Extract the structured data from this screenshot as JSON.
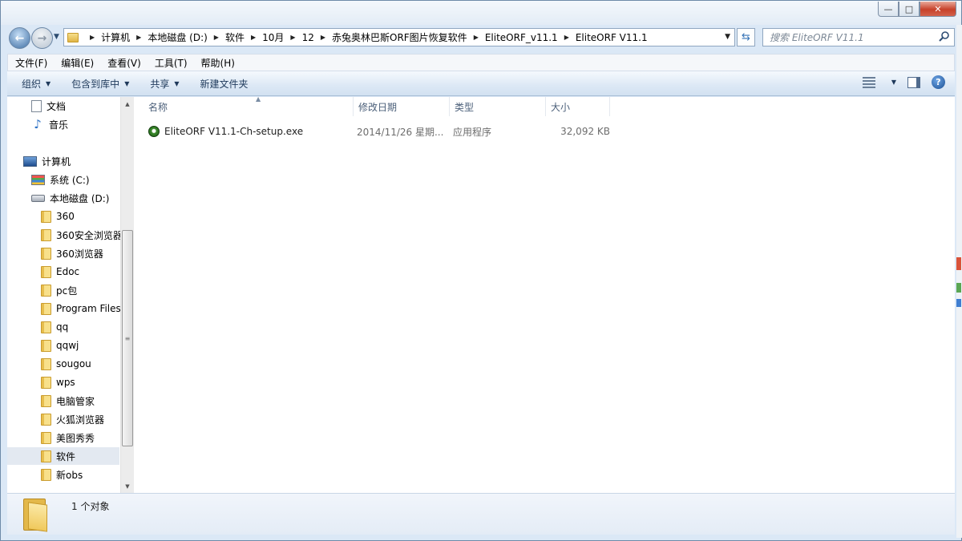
{
  "window": {
    "controls": {
      "minimize": "—",
      "maximize": "□",
      "close": "✕"
    }
  },
  "nav": {
    "back": "←",
    "forward": "→",
    "breadcrumbs": [
      "计算机",
      "本地磁盘 (D:)",
      "软件",
      "10月",
      "12",
      "赤兔奥林巴斯ORF图片恢复软件",
      "EliteORF_v11.1",
      "EliteORF V11.1"
    ],
    "search_placeholder": "搜索 EliteORF V11.1"
  },
  "menu": [
    "文件(F)",
    "编辑(E)",
    "查看(V)",
    "工具(T)",
    "帮助(H)"
  ],
  "toolbar": {
    "organize": "组织",
    "include_in_library": "包含到库中",
    "share": "共享",
    "new_folder": "新建文件夹"
  },
  "tree": [
    {
      "label": "文档",
      "icon": "document-icon",
      "indent": 1
    },
    {
      "label": "音乐",
      "icon": "music-icon",
      "indent": 1
    },
    {
      "label": "计算机",
      "icon": "computer-icon",
      "indent": 0
    },
    {
      "label": "系统 (C:)",
      "icon": "system-drive-icon",
      "indent": 1
    },
    {
      "label": "本地磁盘 (D:)",
      "icon": "drive-icon",
      "indent": 1
    },
    {
      "label": "360",
      "icon": "folder-icon",
      "indent": 2
    },
    {
      "label": "360安全浏览器",
      "icon": "folder-icon",
      "indent": 2
    },
    {
      "label": "360浏览器",
      "icon": "folder-icon",
      "indent": 2
    },
    {
      "label": "Edoc",
      "icon": "folder-icon",
      "indent": 2
    },
    {
      "label": "pc包",
      "icon": "folder-icon",
      "indent": 2
    },
    {
      "label": "Program Files",
      "icon": "folder-icon",
      "indent": 2
    },
    {
      "label": "qq",
      "icon": "folder-icon",
      "indent": 2
    },
    {
      "label": "qqwj",
      "icon": "folder-icon",
      "indent": 2
    },
    {
      "label": "sougou",
      "icon": "folder-icon",
      "indent": 2
    },
    {
      "label": "wps",
      "icon": "folder-icon",
      "indent": 2
    },
    {
      "label": "电脑管家",
      "icon": "folder-icon",
      "indent": 2
    },
    {
      "label": "火狐浏览器",
      "icon": "folder-icon",
      "indent": 2
    },
    {
      "label": "美图秀秀",
      "icon": "folder-icon",
      "indent": 2
    },
    {
      "label": "软件",
      "icon": "folder-icon",
      "indent": 2,
      "selected": true
    },
    {
      "label": "新obs",
      "icon": "folder-icon",
      "indent": 2
    }
  ],
  "columns": [
    "名称",
    "修改日期",
    "类型",
    "大小"
  ],
  "files": [
    {
      "name": "EliteORF V11.1-Ch-setup.exe",
      "modified": "2014/11/26 星期...",
      "type": "应用程序",
      "size": "32,092 KB",
      "icon": "application-icon"
    }
  ],
  "status": {
    "count": "1 个对象"
  }
}
